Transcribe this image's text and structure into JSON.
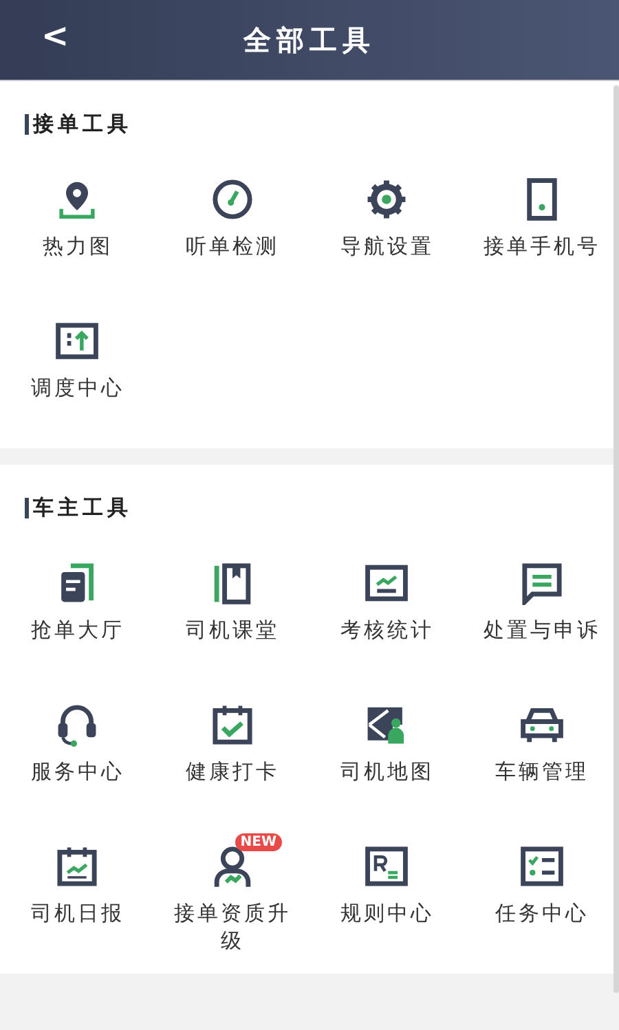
{
  "header": {
    "back": "<",
    "title": "全部工具"
  },
  "sections": [
    {
      "title": "接单工具",
      "items": [
        {
          "label": "热力图"
        },
        {
          "label": "听单检测"
        },
        {
          "label": "导航设置"
        },
        {
          "label": "接单手机号"
        },
        {
          "label": "调度中心"
        }
      ]
    },
    {
      "title": "车主工具",
      "items": [
        {
          "label": "抢单大厅"
        },
        {
          "label": "司机课堂"
        },
        {
          "label": "考核统计"
        },
        {
          "label": "处置与申诉"
        },
        {
          "label": "服务中心"
        },
        {
          "label": "健康打卡"
        },
        {
          "label": "司机地图"
        },
        {
          "label": "车辆管理"
        },
        {
          "label": "司机日报"
        },
        {
          "label": "接单资质升级",
          "badge": "NEW"
        },
        {
          "label": "规则中心"
        },
        {
          "label": "任务中心"
        }
      ]
    }
  ]
}
